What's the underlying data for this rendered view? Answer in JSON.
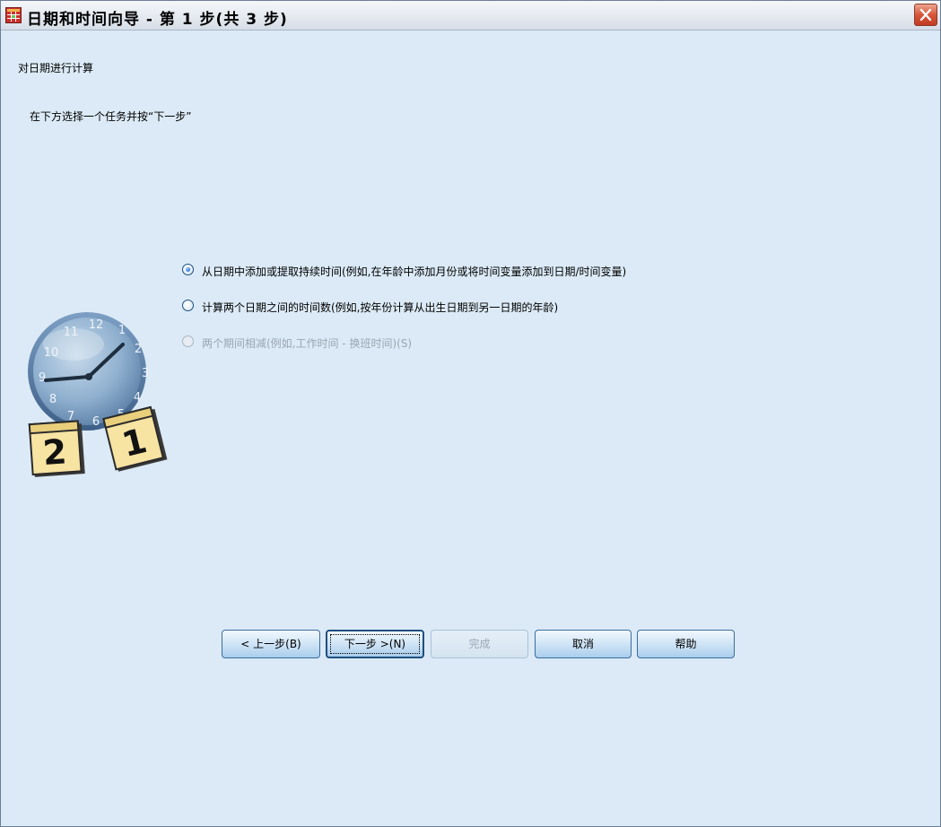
{
  "window": {
    "title": "日期和时间向导 - 第 1 步(共 3 步)",
    "icon": "spss-grid-icon",
    "close_icon": "close-icon"
  },
  "body": {
    "heading": "对日期进行计算",
    "instruction": "在下方选择一个任务并按“下一步”"
  },
  "options": [
    {
      "label": "从日期中添加或提取持续时间(例如,在年龄中添加月份或将时间变量添加到日期/时间变量)",
      "selected": true,
      "enabled": true
    },
    {
      "label": "计算两个日期之间的时间数(例如,按年份计算从出生日期到另一日期的年龄)",
      "selected": false,
      "enabled": true
    },
    {
      "label": "两个期间相减(例如,工作时间 - 换班时间)(S)",
      "selected": false,
      "enabled": false
    }
  ],
  "illustration": {
    "name": "clock-calendar-icon",
    "clock_numbers": [
      "12",
      "1",
      "2",
      "3",
      "4",
      "5",
      "6",
      "7",
      "8",
      "9",
      "10",
      "11"
    ],
    "calendar_left": "2",
    "calendar_right": "1"
  },
  "buttons": {
    "back": "< 上一步(B)",
    "next": "下一步 >(N)",
    "finish": "完成",
    "cancel": "取消",
    "help": "帮助"
  },
  "colors": {
    "dialog_background": "#dbeaf6",
    "title_bar": "#e8ecf2",
    "close_button": "#d7563a",
    "disabled_text": "#9aa5b1",
    "button_face": "#cfe4f6"
  }
}
